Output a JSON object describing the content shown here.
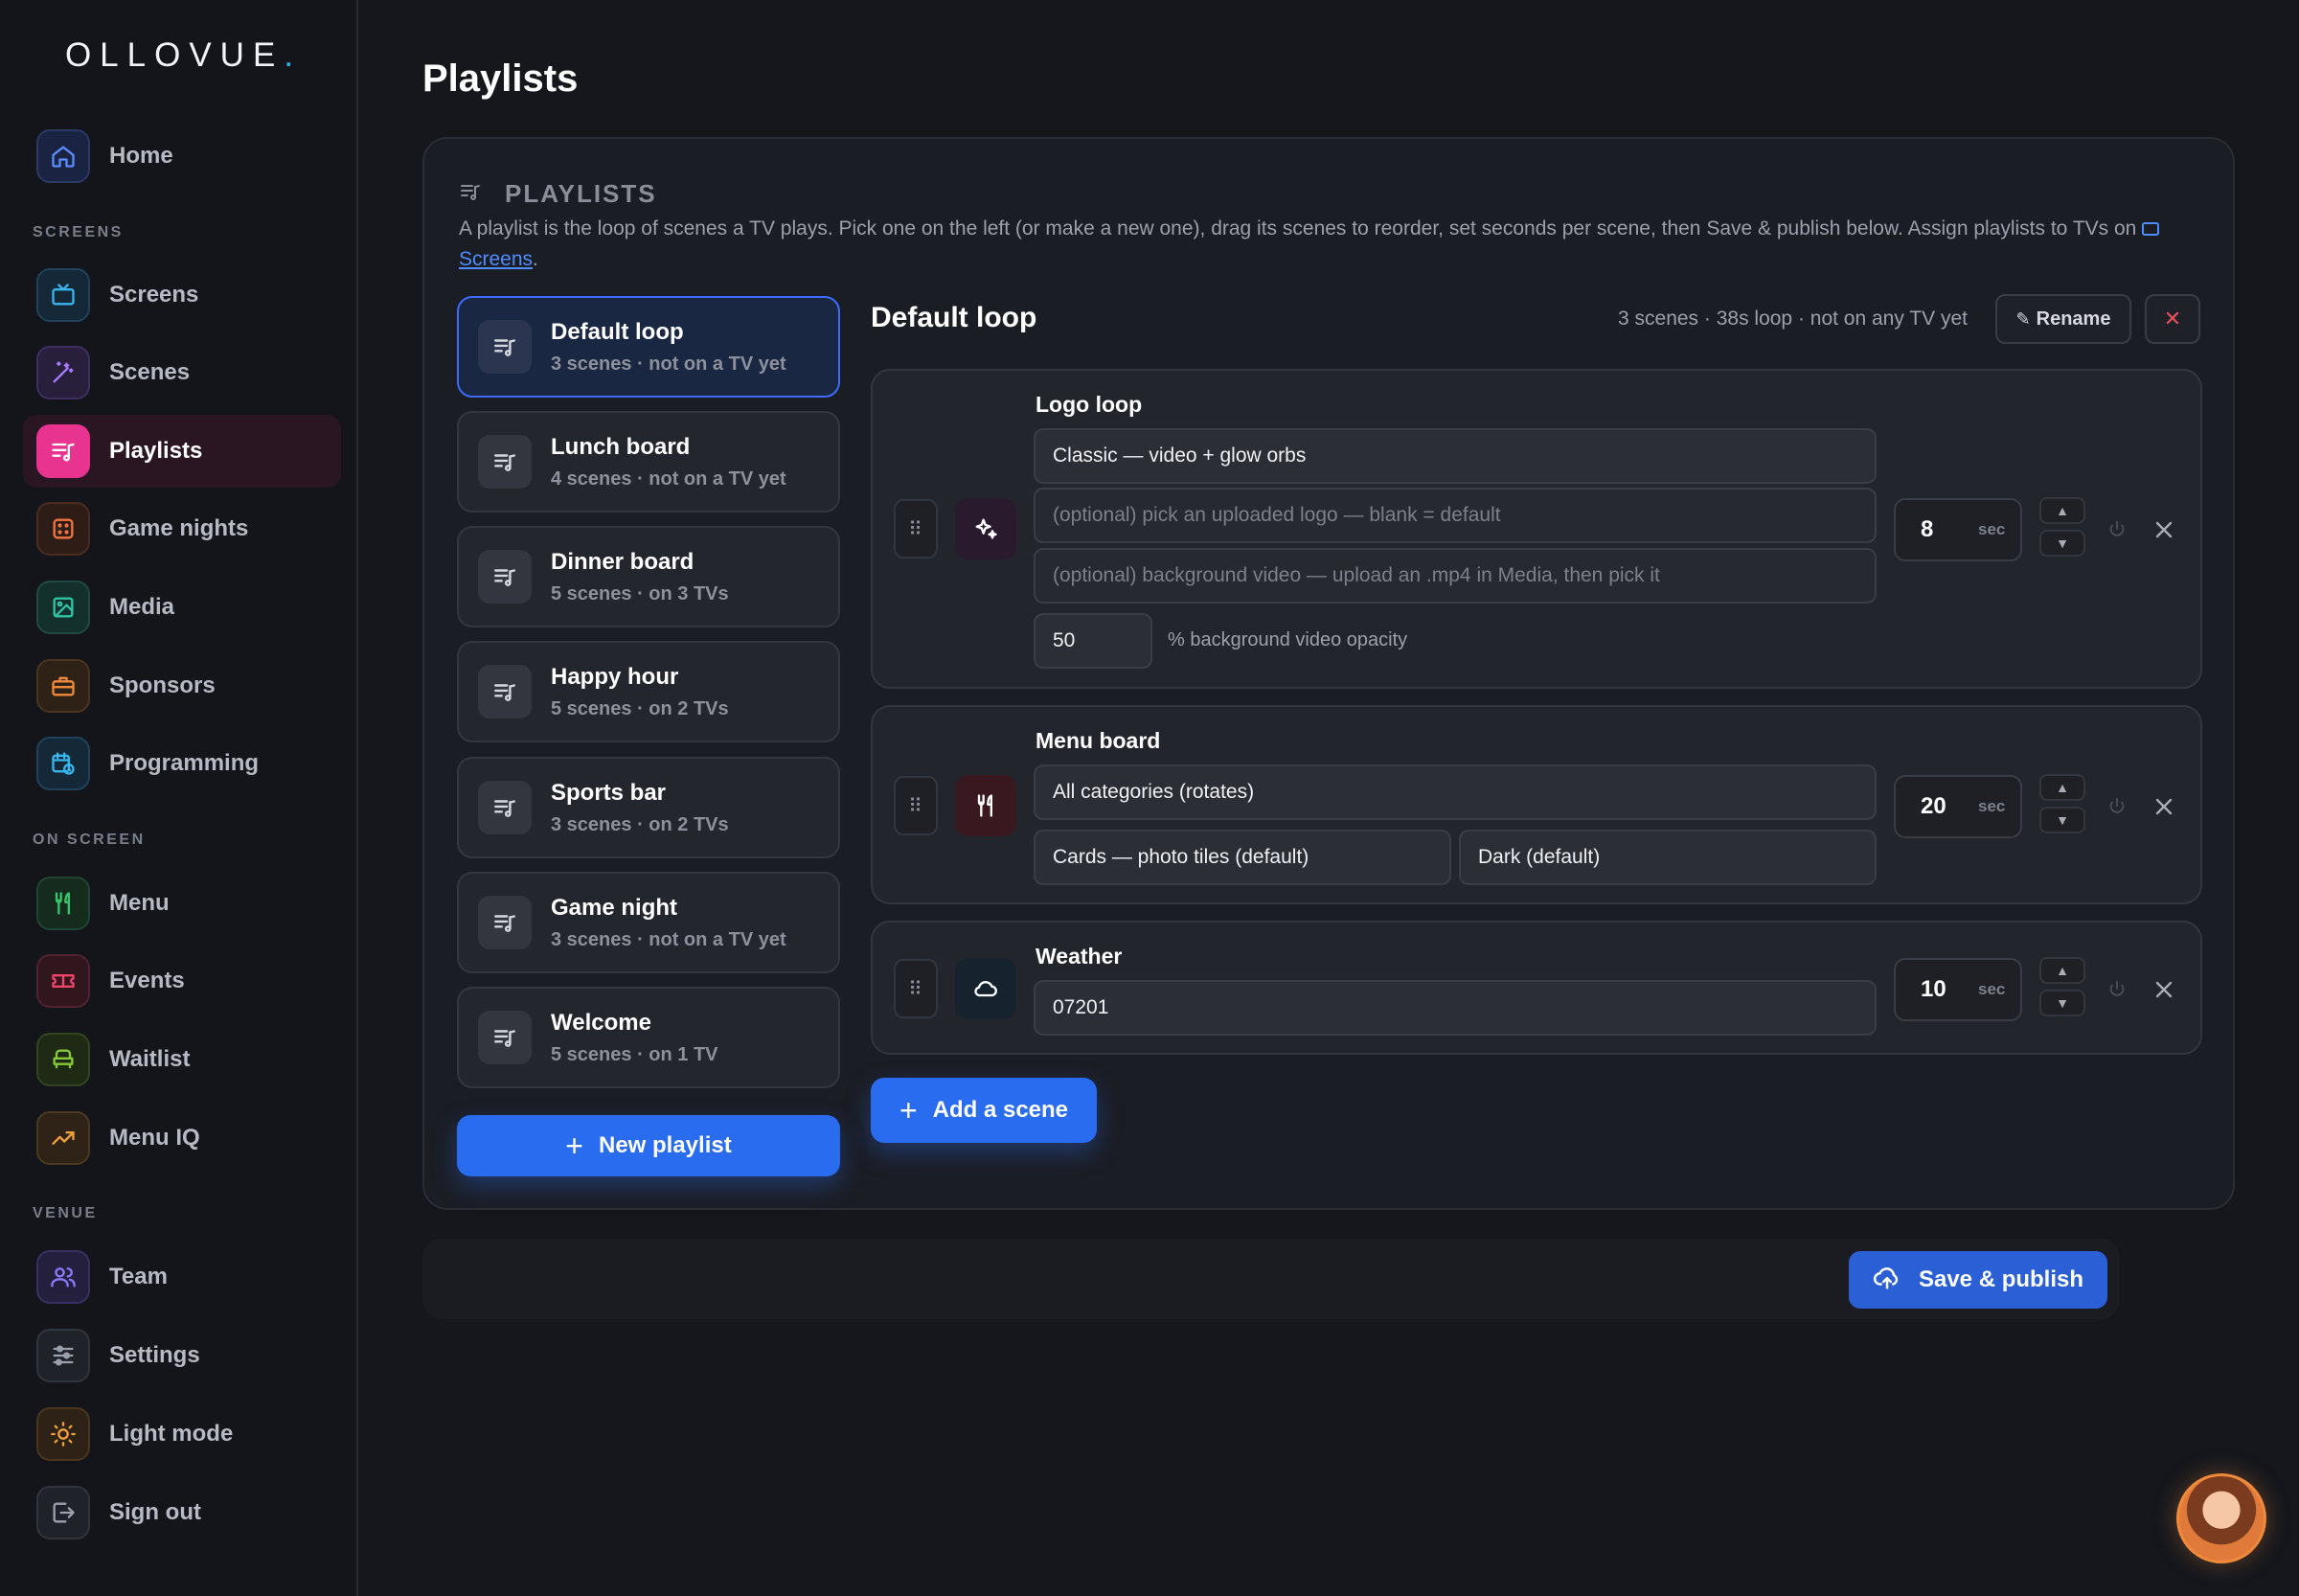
{
  "app": {
    "logo_text": "OLLOVUE",
    "logo_dot": "."
  },
  "sidebar": {
    "sections": {
      "screens": "SCREENS",
      "on_screen": "ON SCREEN",
      "venue": "VENUE"
    },
    "items": [
      {
        "label": "Home",
        "icon": "home-icon"
      },
      {
        "label": "Screens",
        "icon": "tv-icon"
      },
      {
        "label": "Scenes",
        "icon": "magic-wand-icon"
      },
      {
        "label": "Playlists",
        "icon": "playlist-icon"
      },
      {
        "label": "Game nights",
        "icon": "dice-icon"
      },
      {
        "label": "Media",
        "icon": "image-icon"
      },
      {
        "label": "Sponsors",
        "icon": "briefcase-icon"
      },
      {
        "label": "Programming",
        "icon": "calendar-clock-icon"
      },
      {
        "label": "Menu",
        "icon": "utensils-icon"
      },
      {
        "label": "Events",
        "icon": "ticket-icon"
      },
      {
        "label": "Waitlist",
        "icon": "armchair-icon"
      },
      {
        "label": "Menu IQ",
        "icon": "trending-up-icon"
      },
      {
        "label": "Team",
        "icon": "users-icon"
      },
      {
        "label": "Settings",
        "icon": "sliders-icon"
      },
      {
        "label": "Light mode",
        "icon": "sun-icon"
      },
      {
        "label": "Sign out",
        "icon": "log-out-icon"
      }
    ],
    "active": "Playlists"
  },
  "page": {
    "title": "Playlists"
  },
  "panel": {
    "header": "PLAYLISTS",
    "desc_1": "A playlist is the loop of scenes a TV plays. Pick one on the left (or make a new one), drag its scenes to reorder, set seconds per scene, then Save & publish below. Assign playlists to TVs on ",
    "desc_link": "Screens",
    "desc_end": "."
  },
  "playlists": [
    {
      "name": "Default loop",
      "meta": "3 scenes · not on a TV yet"
    },
    {
      "name": "Lunch board",
      "meta": "4 scenes · not on a TV yet"
    },
    {
      "name": "Dinner board",
      "meta": "5 scenes · on 3 TVs"
    },
    {
      "name": "Happy hour",
      "meta": "5 scenes · on 2 TVs"
    },
    {
      "name": "Sports bar",
      "meta": "3 scenes · on 2 TVs"
    },
    {
      "name": "Game night",
      "meta": "3 scenes · not on a TV yet"
    },
    {
      "name": "Welcome",
      "meta": "5 scenes · on 1 TV"
    }
  ],
  "new_playlist_label": "New playlist",
  "editor": {
    "title": "Default loop",
    "meta": "3 scenes · 38s loop · not on any TV yet",
    "rename_label": "Rename",
    "delete_label": "✕",
    "sec_unit": "sec",
    "scenes": [
      {
        "name": "Logo loop",
        "icon": "sparkles-icon",
        "style_value": "Classic — video + glow orbs",
        "logo_placeholder": "(optional) pick an uploaded logo — blank = default",
        "video_placeholder": "(optional) background video — upload an .mp4 in Media, then pick it",
        "opacity_value": "50",
        "opacity_label": "% background video opacity",
        "seconds": "8"
      },
      {
        "name": "Menu board",
        "icon": "utensils-icon",
        "category_value": "All categories (rotates)",
        "layout_value": "Cards — photo tiles (default)",
        "theme_value": "Dark (default)",
        "seconds": "20"
      },
      {
        "name": "Weather",
        "icon": "cloud-icon",
        "zip_value": "07201",
        "seconds": "10"
      }
    ],
    "add_scene_label": "Add a scene"
  },
  "footer": {
    "publish_label": "Save & publish"
  },
  "colors": {
    "accent": "#2a6cf0",
    "active_nav": "#e8338f",
    "background": "#15171d"
  }
}
